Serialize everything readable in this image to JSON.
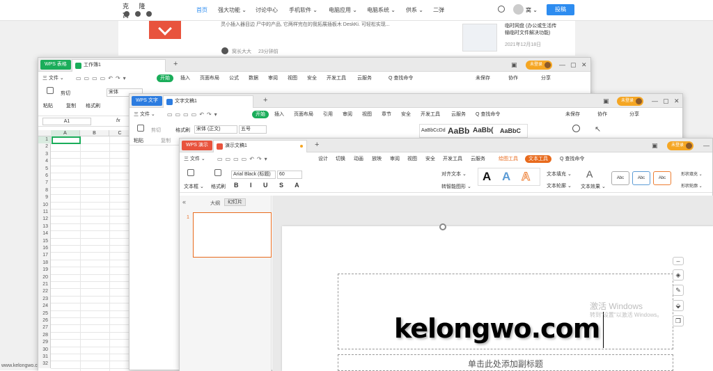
{
  "website": {
    "logo_text": "克 隆 窝",
    "nav": [
      "首页",
      "强大功能 ⌄",
      "讨论中心",
      "手机软件 ⌄",
      "电脑应用 ⌄",
      "电脑系统 ⌄",
      "供系 ⌄",
      "二弹"
    ],
    "user": "窝 ⌄",
    "post_button": "投稿",
    "article_snippet": "灵小插入器目边 尸中的产品, 它两样完在的我拓展插板木 DeskKi. 可轻松实现...",
    "author": "窝长大大",
    "time_ago": "23分钟前",
    "side_title": "临时网盘 (办公或生活传输临时文件解决功能)",
    "side_date": "2021年12月18日",
    "footer_url": "www.kelongwo.com"
  },
  "excel": {
    "app_tab": "WPS 表格",
    "doc_tab": "工作簿1",
    "login": "未登录",
    "menu": [
      "三 文件 ⌄",
      "开始",
      "插入",
      "页面布局",
      "公式",
      "数据",
      "审阅",
      "视图",
      "安全",
      "开发工具",
      "云服务",
      "Q 查找命令"
    ],
    "right_menu": [
      "未保存",
      "协作",
      "分享"
    ],
    "ribbon": {
      "paste": "粘贴",
      "cut": "剪切",
      "copy": "复制",
      "format_painter": "格式刷",
      "font": "宋体"
    },
    "cell_ref": "A1",
    "fx": "fx",
    "columns": [
      "A",
      "B",
      "C"
    ],
    "rows": [
      "1",
      "2",
      "3",
      "4",
      "5",
      "6",
      "7",
      "8",
      "9",
      "10",
      "11",
      "12",
      "13",
      "14",
      "15",
      "16",
      "17",
      "18",
      "19",
      "20",
      "21",
      "22",
      "23",
      "24",
      "25",
      "26",
      "27",
      "28",
      "29",
      "30",
      "31",
      "32"
    ]
  },
  "writer": {
    "app_tab": "WPS 文字",
    "doc_tab": "文字文稿1",
    "login": "未登录",
    "menu": [
      "三 文件 ⌄",
      "开始",
      "插入",
      "页面布局",
      "引用",
      "审阅",
      "视图",
      "章节",
      "安全",
      "开发工具",
      "云服务",
      "Q 查找命令"
    ],
    "right_menu": [
      "未保存",
      "协作",
      "分享"
    ],
    "ribbon": {
      "paste": "粘贴",
      "cut": "剪切",
      "copy": "复制",
      "format_painter": "格式刷",
      "font": "宋体 (正文)",
      "size": "五号"
    },
    "styles": [
      "AaBbCcDd",
      "AaBb",
      "AaBb(",
      "AaBbC"
    ]
  },
  "presentation": {
    "app_tab": "WPS 演示",
    "doc_tab": "演示文稿1",
    "login": "未登录",
    "menu": [
      "三 文件 ⌄",
      "设计",
      "切换",
      "动画",
      "放映",
      "审阅",
      "视图",
      "安全",
      "开发工具",
      "云服务",
      "绘图工具",
      "文本工具",
      "Q 查找命令"
    ],
    "right_menu": [
      "未保存",
      "协作",
      "分享"
    ],
    "ribbon": {
      "textbox": "文本框 ⌄",
      "format_painter": "格式刷",
      "font": "Arial Black (标题)",
      "size": "60",
      "align_text": "对齐文本 ⌄",
      "smartart": "转智能图形 ⌄",
      "text_fill": "文本填充 ⌄",
      "text_outline": "文本轮廓 ⌄",
      "text_effect": "文本效果 ⌄",
      "shape_fill": "形状填充 ⌄",
      "shape_outline": "形状轮廓 ⌄",
      "abc": "Abc"
    },
    "panel_tabs": [
      "大纲",
      "幻灯片"
    ],
    "slide_number": "1",
    "title_text": "kelongwo.com",
    "subtitle_placeholder": "单击此处添加副标题",
    "watermark_line1": "激活 Windows",
    "watermark_line2": "转到\"设置\"以激活 Windows。"
  },
  "colors": {
    "wps_red": "#e8533d",
    "wps_blue": "#2c7ce0",
    "wps_green": "#1aad5a",
    "accent_orange": "#e86a1c"
  }
}
